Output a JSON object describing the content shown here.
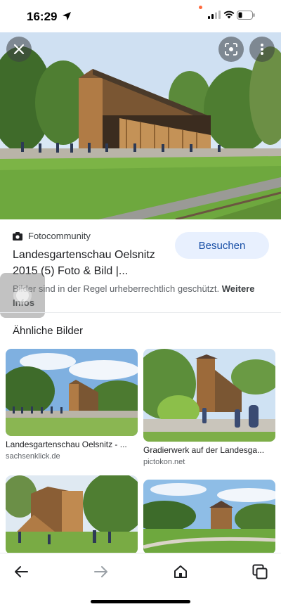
{
  "status_bar": {
    "time": "16:29"
  },
  "result": {
    "source": "Fotocommunity",
    "title": "Landesgartenschau Oelsnitz 2015 (5) Foto & Bild |...",
    "visit_label": "Besuchen",
    "copyright_text": "Bilder sind in der Regel urheberrechtlich geschützt.",
    "more_info_label": "Weitere Infos"
  },
  "similar": {
    "heading": "Ähnliche Bilder",
    "items": [
      {
        "caption": "Landesgartenschau Oelsnitz - ...",
        "domain": "sachsenklick.de"
      },
      {
        "caption": "Gradierwerk auf der Landesga...",
        "domain": "pictokon.net"
      },
      {
        "caption": "",
        "domain": ""
      },
      {
        "caption": "",
        "domain": ""
      }
    ]
  },
  "icons": {
    "close": "close-icon",
    "lens": "lens-icon",
    "more": "more-vert-icon",
    "back": "arrow-back-icon",
    "forward": "arrow-forward-icon",
    "home": "home-icon",
    "tabs": "tabs-icon"
  },
  "colors": {
    "visit_button_bg": "#e8f0fe",
    "visit_button_text": "#174ea6",
    "sky": "#cfe0f2",
    "grass": "#6ea83e",
    "wood": "#a8733f"
  }
}
